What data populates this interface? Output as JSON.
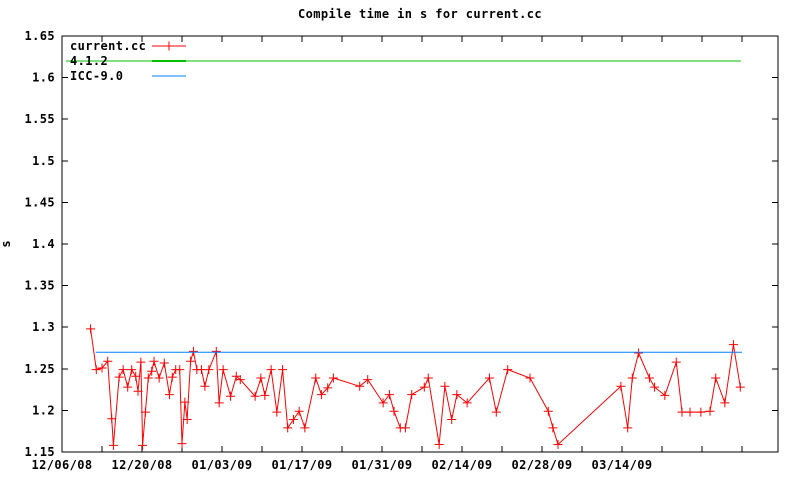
{
  "title": "Compile time in s for current.cc",
  "chart_data": {
    "type": "line",
    "title": "Compile time in s for current.cc",
    "xlabel": "",
    "ylabel": "s",
    "ylim": [
      1.15,
      1.65
    ],
    "ytick_step": 0.05,
    "ytick_labels": [
      "1.15",
      "1.2",
      "1.25",
      "1.3",
      "1.35",
      "1.4",
      "1.45",
      "1.5",
      "1.55",
      "1.6",
      "1.65"
    ],
    "x_unit": "days since 12/06/08",
    "xlim_days": [
      0,
      125.3
    ],
    "xtick_minor_step_days": 7,
    "xtick_labels": [
      {
        "day": 0,
        "label": "12/06/08"
      },
      {
        "day": 14,
        "label": "12/20/08"
      },
      {
        "day": 28,
        "label": "01/03/09"
      },
      {
        "day": 42,
        "label": "01/17/09"
      },
      {
        "day": 56,
        "label": "01/31/09"
      },
      {
        "day": 70,
        "label": "02/14/09"
      },
      {
        "day": 84,
        "label": "02/28/09"
      },
      {
        "day": 98,
        "label": "03/14/09"
      }
    ],
    "grid": false,
    "legend_position": "top-left",
    "series": [
      {
        "name": "current.cc",
        "color": "#ff0000",
        "marker": "plus",
        "points": [
          [
            5,
            1.298
          ],
          [
            6,
            1.249
          ],
          [
            7,
            1.251
          ],
          [
            8,
            1.259
          ],
          [
            8.7,
            1.19
          ],
          [
            9,
            1.158
          ],
          [
            10,
            1.24
          ],
          [
            10.7,
            1.249
          ],
          [
            11.5,
            1.228
          ],
          [
            12.2,
            1.249
          ],
          [
            12.9,
            1.241
          ],
          [
            13.3,
            1.223
          ],
          [
            13.8,
            1.258
          ],
          [
            14.1,
            1.158
          ],
          [
            14.6,
            1.198
          ],
          [
            15.1,
            1.239
          ],
          [
            15.7,
            1.247
          ],
          [
            16.1,
            1.259
          ],
          [
            17,
            1.239
          ],
          [
            17.9,
            1.257
          ],
          [
            18.8,
            1.219
          ],
          [
            19.3,
            1.24
          ],
          [
            19.9,
            1.249
          ],
          [
            20.6,
            1.249
          ],
          [
            21,
            1.16
          ],
          [
            21.5,
            1.21
          ],
          [
            21.9,
            1.189
          ],
          [
            22.5,
            1.259
          ],
          [
            23,
            1.271
          ],
          [
            23.6,
            1.249
          ],
          [
            24.4,
            1.249
          ],
          [
            25,
            1.229
          ],
          [
            25.7,
            1.249
          ],
          [
            27,
            1.271
          ],
          [
            27.5,
            1.209
          ],
          [
            28.2,
            1.249
          ],
          [
            29.5,
            1.217
          ],
          [
            30.5,
            1.241
          ],
          [
            31.2,
            1.237
          ],
          [
            33.8,
            1.217
          ],
          [
            34.8,
            1.239
          ],
          [
            35.5,
            1.218
          ],
          [
            36.6,
            1.249
          ],
          [
            37.6,
            1.198
          ],
          [
            38.6,
            1.249
          ],
          [
            39.5,
            1.179
          ],
          [
            40.5,
            1.189
          ],
          [
            41.5,
            1.199
          ],
          [
            42.5,
            1.179
          ],
          [
            44.4,
            1.239
          ],
          [
            45.4,
            1.219
          ],
          [
            46.5,
            1.227
          ],
          [
            47.5,
            1.239
          ],
          [
            52.1,
            1.229
          ],
          [
            53.5,
            1.237
          ],
          [
            56.2,
            1.209
          ],
          [
            57.3,
            1.219
          ],
          [
            58.1,
            1.199
          ],
          [
            59.2,
            1.179
          ],
          [
            60.1,
            1.179
          ],
          [
            61.2,
            1.219
          ],
          [
            63.4,
            1.228
          ],
          [
            64.1,
            1.239
          ],
          [
            66,
            1.159
          ],
          [
            67,
            1.229
          ],
          [
            68.2,
            1.189
          ],
          [
            69.1,
            1.219
          ],
          [
            70.9,
            1.209
          ],
          [
            74.8,
            1.239
          ],
          [
            76,
            1.198
          ],
          [
            78,
            1.249
          ],
          [
            81.9,
            1.239
          ],
          [
            85.1,
            1.199
          ],
          [
            85.9,
            1.179
          ],
          [
            86.8,
            1.159
          ],
          [
            97.8,
            1.229
          ],
          [
            99,
            1.179
          ],
          [
            99.8,
            1.239
          ],
          [
            100.9,
            1.269
          ],
          [
            102.8,
            1.239
          ],
          [
            103.7,
            1.228
          ],
          [
            105.5,
            1.218
          ],
          [
            107.5,
            1.258
          ],
          [
            108.5,
            1.198
          ],
          [
            109.9,
            1.198
          ],
          [
            111.8,
            1.198
          ],
          [
            113.4,
            1.199
          ],
          [
            114.4,
            1.239
          ],
          [
            116,
            1.209
          ],
          [
            117.5,
            1.279
          ],
          [
            118.7,
            1.228
          ]
        ]
      },
      {
        "name": "4.1.2",
        "color": "#00c000",
        "marker": "none",
        "points": [
          [
            0.7,
            1.62
          ],
          [
            118.8,
            1.62
          ]
        ]
      },
      {
        "name": "ICC-9.0",
        "color": "#0080ff",
        "marker": "none",
        "points": [
          [
            5.9,
            1.27
          ],
          [
            119.0,
            1.27
          ]
        ]
      }
    ]
  },
  "colors": {
    "foreground": "#000000",
    "background": "#ffffff",
    "series_red": "#ff0000",
    "series_green": "#00c000",
    "series_blue": "#0080ff"
  }
}
